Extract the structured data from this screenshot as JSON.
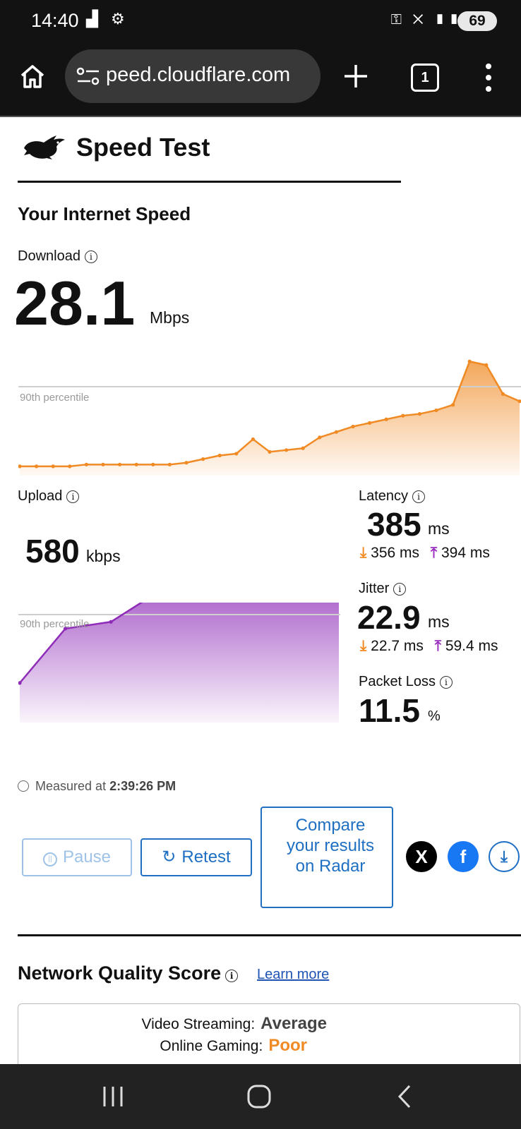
{
  "status": {
    "time": "14:40",
    "battery": "69"
  },
  "browser": {
    "url": "peed.cloudflare.com",
    "tabs_count": "1"
  },
  "header": {
    "title": "Speed Test"
  },
  "section_title": "Your Internet Speed",
  "download": {
    "label": "Download",
    "value": "28.1",
    "unit": "Mbps",
    "percentile_label": "90th percentile",
    "chart_data": {
      "type": "area",
      "color": "#f08a24",
      "values": [
        2,
        2,
        2,
        2,
        3,
        3,
        3,
        3,
        3,
        3,
        4,
        6,
        8,
        9,
        17,
        10,
        11,
        12,
        18,
        21,
        24,
        26,
        28,
        30,
        31,
        33,
        36,
        60,
        58,
        42,
        38
      ]
    }
  },
  "upload": {
    "label": "Upload",
    "value": "580",
    "unit": "kbps",
    "percentile_label": "90th percentile",
    "chart_data": {
      "type": "area",
      "color": "#8e2bb8",
      "values": [
        20,
        52,
        56,
        73,
        76,
        74,
        71,
        75
      ]
    }
  },
  "latency": {
    "label": "Latency",
    "value": "385",
    "unit": "ms",
    "down": "356 ms",
    "up": "394 ms"
  },
  "jitter": {
    "label": "Jitter",
    "value": "22.9",
    "unit": "ms",
    "down": "22.7 ms",
    "up": "59.4 ms"
  },
  "packet_loss": {
    "label": "Packet Loss",
    "value": "11.5",
    "unit": "%"
  },
  "measured": {
    "prefix": "Measured at",
    "time": "2:39:26 PM"
  },
  "buttons": {
    "pause": "Pause",
    "retest": "Retest",
    "compare": "Compare your results on Radar"
  },
  "network_quality": {
    "title": "Network Quality Score",
    "learn_more": "Learn more",
    "rows": [
      {
        "label": "Video Streaming:",
        "value": "Average",
        "color": "#444444"
      },
      {
        "label": "Online Gaming:",
        "value": "Poor",
        "color": "#f08a24"
      }
    ]
  }
}
